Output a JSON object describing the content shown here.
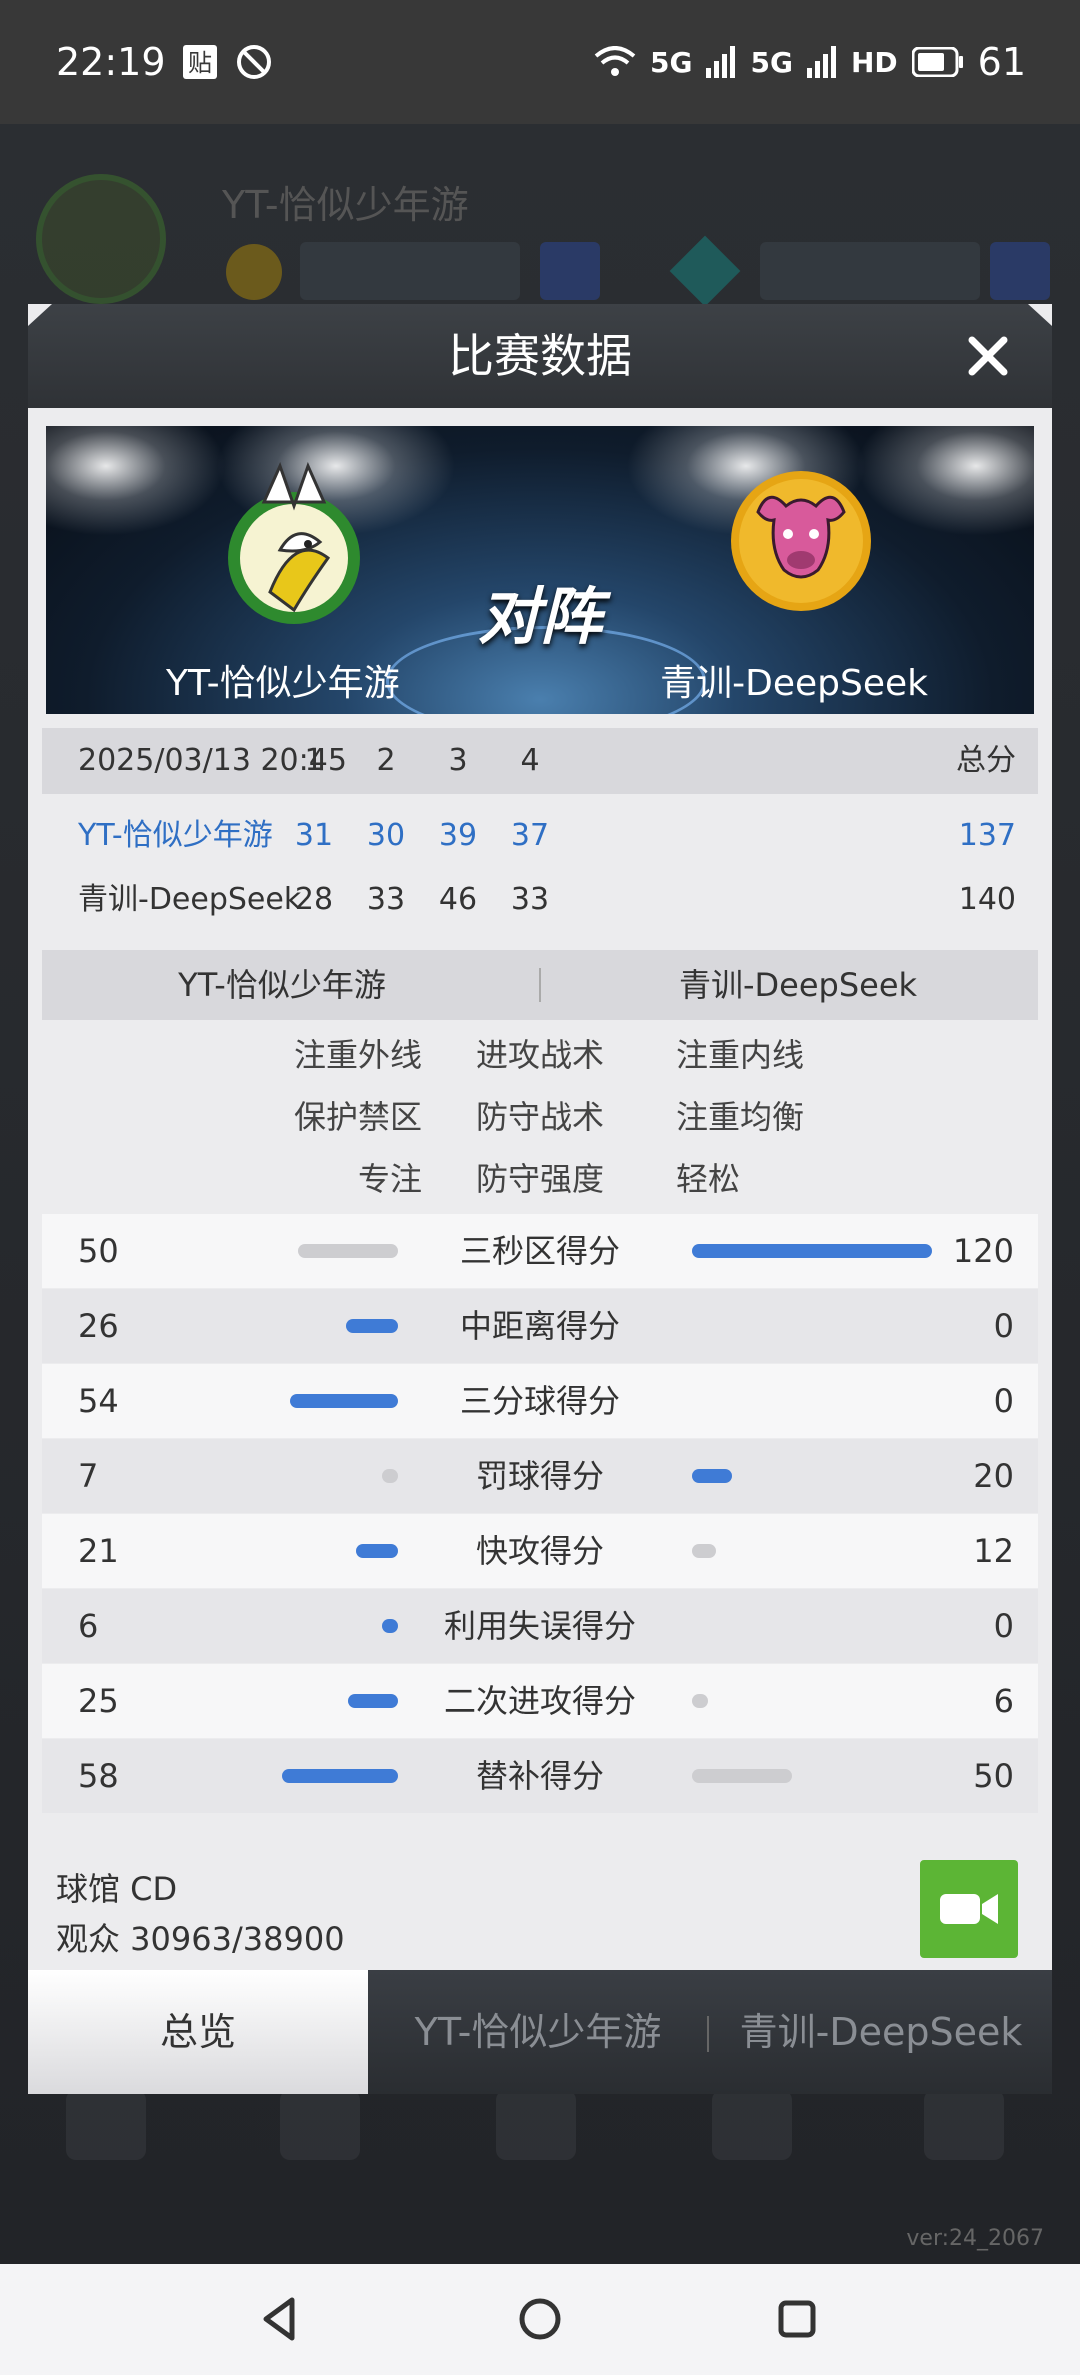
{
  "status_bar": {
    "time": "22:19",
    "sticker_icon": "贴",
    "network": "5G",
    "network2": "5G",
    "hd": "HD",
    "battery": "61"
  },
  "background": {
    "team_name": "YT-恰似少年游",
    "version": "ver:24_2067"
  },
  "modal": {
    "title": "比赛数据",
    "close_icon": "close-icon"
  },
  "banner": {
    "vs_text": "对阵",
    "home_team": "YT-恰似少年游",
    "away_team": "青训-DeepSeek"
  },
  "scoreboard": {
    "date": "2025/03/13 20:45",
    "quarters": [
      "1",
      "2",
      "3",
      "4"
    ],
    "total_label": "总分",
    "rows": [
      {
        "team": "YT-恰似少年游",
        "q": [
          "31",
          "30",
          "39",
          "37"
        ],
        "total": "137"
      },
      {
        "team": "青训-DeepSeek",
        "q": [
          "28",
          "33",
          "46",
          "33"
        ],
        "total": "140"
      }
    ]
  },
  "tactics": {
    "home": "YT-恰似少年游",
    "away": "青训-DeepSeek",
    "rows": [
      {
        "home": "注重外线",
        "label": "进攻战术",
        "away": "注重内线"
      },
      {
        "home": "保护禁区",
        "label": "防守战术",
        "away": "注重均衡"
      },
      {
        "home": "专注",
        "label": "防守强度",
        "away": "轻松"
      }
    ]
  },
  "stats": [
    {
      "label": "三秒区得分",
      "home": "50",
      "away": "120"
    },
    {
      "label": "中距离得分",
      "home": "26",
      "away": "0"
    },
    {
      "label": "三分球得分",
      "home": "54",
      "away": "0"
    },
    {
      "label": "罚球得分",
      "home": "7",
      "away": "20"
    },
    {
      "label": "快攻得分",
      "home": "21",
      "away": "12"
    },
    {
      "label": "利用失误得分",
      "home": "6",
      "away": "0"
    },
    {
      "label": "二次进攻得分",
      "home": "25",
      "away": "6"
    },
    {
      "label": "替补得分",
      "home": "58",
      "away": "50"
    }
  ],
  "venue": {
    "arena": "球馆 CD",
    "attendance": "观众 30963/38900"
  },
  "tabs": [
    {
      "label": "总览",
      "active": true
    },
    {
      "label": "YT-恰似少年游",
      "active": false
    },
    {
      "label": "青训-DeepSeek",
      "active": false
    }
  ],
  "colors": {
    "accent_blue": "#3f7bd6",
    "video_green": "#5cb535",
    "home_team_text": "#2f6fc4"
  }
}
